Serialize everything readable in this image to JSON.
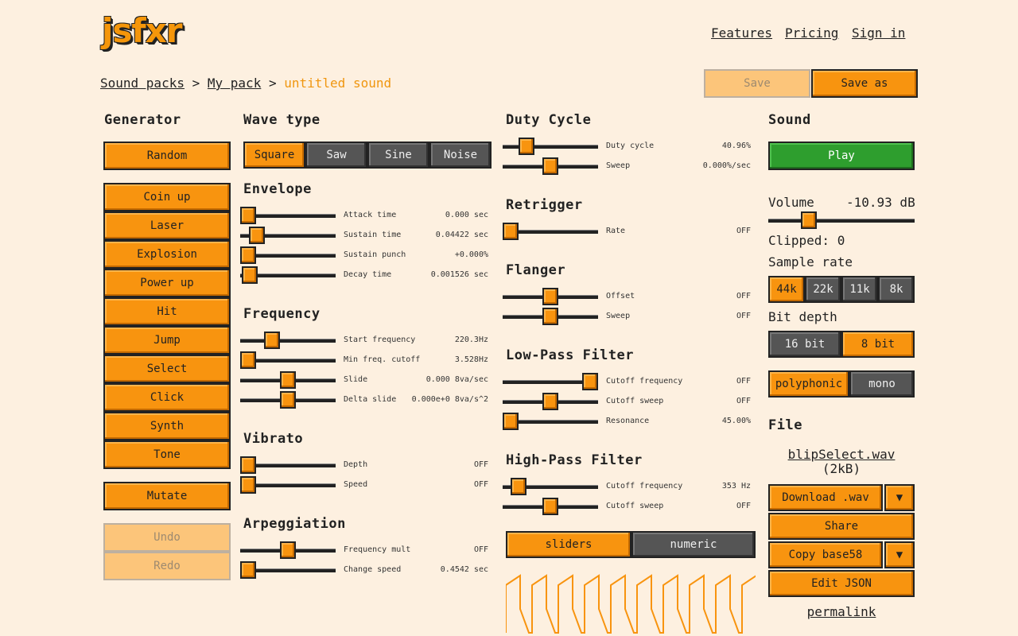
{
  "header": {
    "logo": "jsfxr",
    "nav": [
      "Features",
      "Pricing",
      "Sign in"
    ]
  },
  "breadcrumb": {
    "items": [
      "Sound packs",
      "My pack"
    ],
    "current": "untitled sound",
    "sep": ">"
  },
  "toolbar": {
    "save": "Save",
    "save_as": "Save as"
  },
  "generator": {
    "title": "Generator",
    "random": "Random",
    "items": [
      "Coin up",
      "Laser",
      "Explosion",
      "Power up",
      "Hit",
      "Jump",
      "Select",
      "Click",
      "Synth",
      "Tone"
    ],
    "mutate": "Mutate",
    "undo": "Undo",
    "redo": "Redo"
  },
  "wave": {
    "title": "Wave type",
    "options": [
      "Square",
      "Saw",
      "Sine",
      "Noise"
    ],
    "selected": "Square"
  },
  "sections": [
    {
      "title": "Envelope",
      "sliders": [
        {
          "label": "Attack time",
          "value": "0.000 sec",
          "pos": 0.0
        },
        {
          "label": "Sustain time",
          "value": "0.04422 sec",
          "pos": 0.11
        },
        {
          "label": "Sustain punch",
          "value": "+0.000%",
          "pos": 0.0
        },
        {
          "label": "Decay time",
          "value": "0.001526 sec",
          "pos": 0.02
        }
      ]
    },
    {
      "title": "Frequency",
      "sliders": [
        {
          "label": "Start frequency",
          "value": "220.3Hz",
          "pos": 0.3
        },
        {
          "label": "Min freq. cutoff",
          "value": "3.528Hz",
          "pos": 0.0
        },
        {
          "label": "Slide",
          "value": "0.000 8va/sec",
          "pos": 0.5
        },
        {
          "label": "Delta slide",
          "value": "0.000e+0 8va/s^2",
          "pos": 0.5
        }
      ]
    },
    {
      "title": "Vibrato",
      "sliders": [
        {
          "label": "Depth",
          "value": "OFF",
          "pos": 0.0
        },
        {
          "label": "Speed",
          "value": "OFF",
          "pos": 0.0
        }
      ]
    },
    {
      "title": "Arpeggiation",
      "sliders": [
        {
          "label": "Frequency mult",
          "value": "OFF",
          "pos": 0.5
        },
        {
          "label": "Change speed",
          "value": "0.4542 sec",
          "pos": 0.0
        }
      ]
    },
    {
      "title": "Duty Cycle",
      "sliders": [
        {
          "label": "Duty cycle",
          "value": "40.96%",
          "pos": 0.2
        },
        {
          "label": "Sweep",
          "value": "0.000%/sec",
          "pos": 0.5
        }
      ]
    },
    {
      "title": "Retrigger",
      "sliders": [
        {
          "label": "Rate",
          "value": "OFF",
          "pos": 0.0
        }
      ]
    },
    {
      "title": "Flanger",
      "sliders": [
        {
          "label": "Offset",
          "value": "OFF",
          "pos": 0.5
        },
        {
          "label": "Sweep",
          "value": "OFF",
          "pos": 0.5
        }
      ]
    },
    {
      "title": "Low-Pass Filter",
      "sliders": [
        {
          "label": "Cutoff frequency",
          "value": "OFF",
          "pos": 1.0
        },
        {
          "label": "Cutoff sweep",
          "value": "OFF",
          "pos": 0.5
        },
        {
          "label": "Resonance",
          "value": "45.00%",
          "pos": 0.0
        }
      ]
    },
    {
      "title": "High-Pass Filter",
      "sliders": [
        {
          "label": "Cutoff frequency",
          "value": "353 Hz",
          "pos": 0.1
        },
        {
          "label": "Cutoff sweep",
          "value": "OFF",
          "pos": 0.5
        }
      ]
    }
  ],
  "view_toggle": {
    "options": [
      "sliders",
      "numeric"
    ],
    "selected": "sliders"
  },
  "sound": {
    "title": "Sound",
    "play": "Play",
    "volume_label": "Volume",
    "volume_value": "-10.93 dB",
    "volume_pos": 0.25,
    "clipped_label": "Clipped: 0",
    "sample_rate_label": "Sample rate",
    "sample_rates": [
      "44k",
      "22k",
      "11k",
      "8k"
    ],
    "sample_rate_selected": "44k",
    "bit_depth_label": "Bit depth",
    "bit_depths": [
      "16 bit",
      "8 bit"
    ],
    "bit_depth_selected": "8 bit",
    "modes": [
      "polyphonic",
      "mono"
    ],
    "mode_selected": "polyphonic"
  },
  "file": {
    "title": "File",
    "filename": "blipSelect.wav",
    "size": "(2kB)",
    "download": "Download .wav",
    "share": "Share",
    "copy": "Copy base58",
    "edit_json": "Edit JSON",
    "permalink": "permalink",
    "dropdown_glyph": "▼"
  },
  "colors": {
    "accent": "#f8940f",
    "background": "#fdf0e0",
    "play": "#2e9e2e",
    "unselected": "#555555"
  }
}
